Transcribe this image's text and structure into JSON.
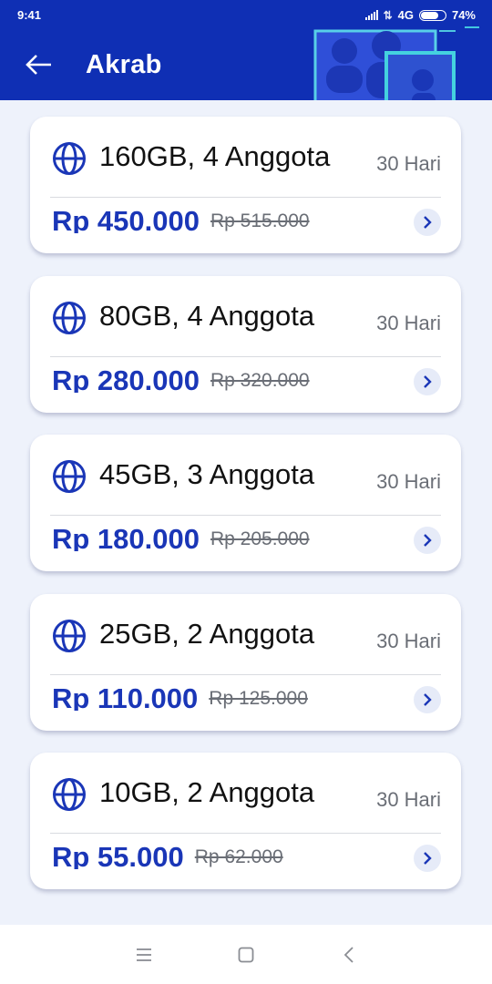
{
  "status_bar": {
    "time": "9:41",
    "network": "4G",
    "battery": "74%"
  },
  "header": {
    "title": "Akrab",
    "back_icon": "arrow-left-icon",
    "accent_color": "#0f2fb4"
  },
  "offers": [
    {
      "name": "160GB, 4 Anggota",
      "duration": "30 Hari",
      "price": "Rp 450.000",
      "old_price": "Rp 515.000"
    },
    {
      "name": "80GB, 4 Anggota",
      "duration": "30 Hari",
      "price": "Rp 280.000",
      "old_price": "Rp 320.000"
    },
    {
      "name": "45GB, 3 Anggota",
      "duration": "30 Hari",
      "price": "Rp 180.000",
      "old_price": "Rp 205.000"
    },
    {
      "name": "25GB, 2 Anggota",
      "duration": "30 Hari",
      "price": "Rp 110.000",
      "old_price": "Rp 125.000"
    },
    {
      "name": "10GB, 2 Anggota",
      "duration": "30 Hari",
      "price": "Rp 55.000",
      "old_price": "Rp 62.000"
    }
  ],
  "colors": {
    "price": "#1a36b7",
    "page_background": "#eef2fb"
  },
  "nav_bar": {
    "icons": [
      "menu-icon",
      "home-square-icon",
      "back-chevron-icon"
    ]
  }
}
